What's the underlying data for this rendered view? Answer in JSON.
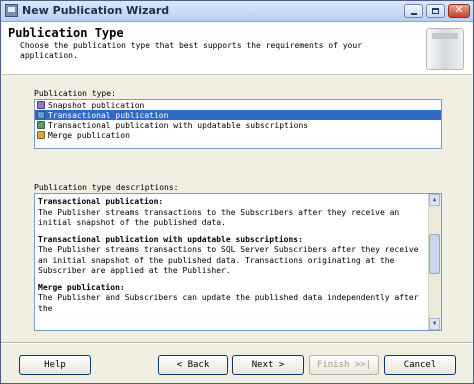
{
  "window": {
    "title": "New Publication Wizard",
    "icons": {
      "app": "wizard-app-icon",
      "minimize": "minimize-icon",
      "maximize": "maximize-icon",
      "close": "close-icon"
    },
    "close_glyph": "✕"
  },
  "header": {
    "title": "Publication Type",
    "description": "Choose the publication type that best supports the requirements of your application."
  },
  "publication_type": {
    "label": "Publication type:",
    "selected_index": 1,
    "items": [
      {
        "label": "Snapshot publication",
        "icon": "snapshot-publication-icon"
      },
      {
        "label": "Transactional publication",
        "icon": "transactional-publication-icon"
      },
      {
        "label": "Transactional publication with updatable subscriptions",
        "icon": "updatable-publication-icon"
      },
      {
        "label": "Merge publication",
        "icon": "merge-publication-icon"
      }
    ]
  },
  "descriptions": {
    "label": "Publication type descriptions:",
    "sections": [
      {
        "title": "Transactional publication:",
        "text": "The Publisher streams transactions to the Subscribers after they receive an initial snapshot of the published data."
      },
      {
        "title": "Transactional publication with updatable subscriptions:",
        "text": "The Publisher streams transactions to SQL Server Subscribers after they receive an initial snapshot of the published data. Transactions originating at the Subscriber are applied at the Publisher."
      },
      {
        "title": "Merge publication:",
        "text": "The Publisher and Subscribers can update the published data independently after the"
      }
    ]
  },
  "buttons": {
    "help": "Help",
    "back": "< Back",
    "next": "Next >",
    "finish": "Finish >>|",
    "cancel": "Cancel"
  },
  "scrollbar": {
    "up": "▲",
    "down": "▼"
  }
}
